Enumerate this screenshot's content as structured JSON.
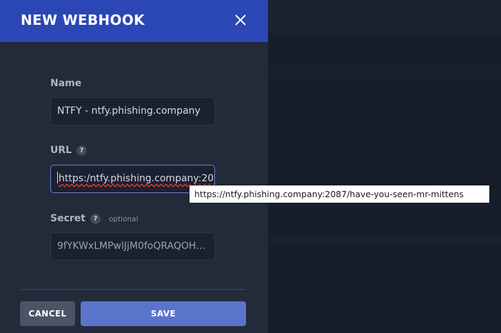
{
  "modal": {
    "title": "NEW WEBHOOK",
    "close_icon": "close-icon"
  },
  "form": {
    "name": {
      "label": "Name",
      "value": "NTFY - ntfy.phishing.company"
    },
    "url": {
      "label": "URL",
      "help": "?",
      "value_prefix": "https:/",
      "value_rest": "ntfy.phishing.company:208",
      "full_value": "https://ntfy.phishing.company:2087/have-you-seen-mr-mittens"
    },
    "secret": {
      "label": "Secret",
      "help": "?",
      "optional": "optional",
      "value": "9fYKWxLMPwlJjM0foQRAQOH0..."
    }
  },
  "tooltip": {
    "text": "https://ntfy.phishing.company:2087/have-you-seen-mr-mittens"
  },
  "actions": {
    "cancel_label": "CANCEL",
    "save_label": "SAVE"
  },
  "colors": {
    "header": "#2b47b5",
    "modal_bg": "#232b3a",
    "save_button": "#5a74cc",
    "cancel_button": "#495466",
    "focus_border": "#6c7fcf"
  }
}
